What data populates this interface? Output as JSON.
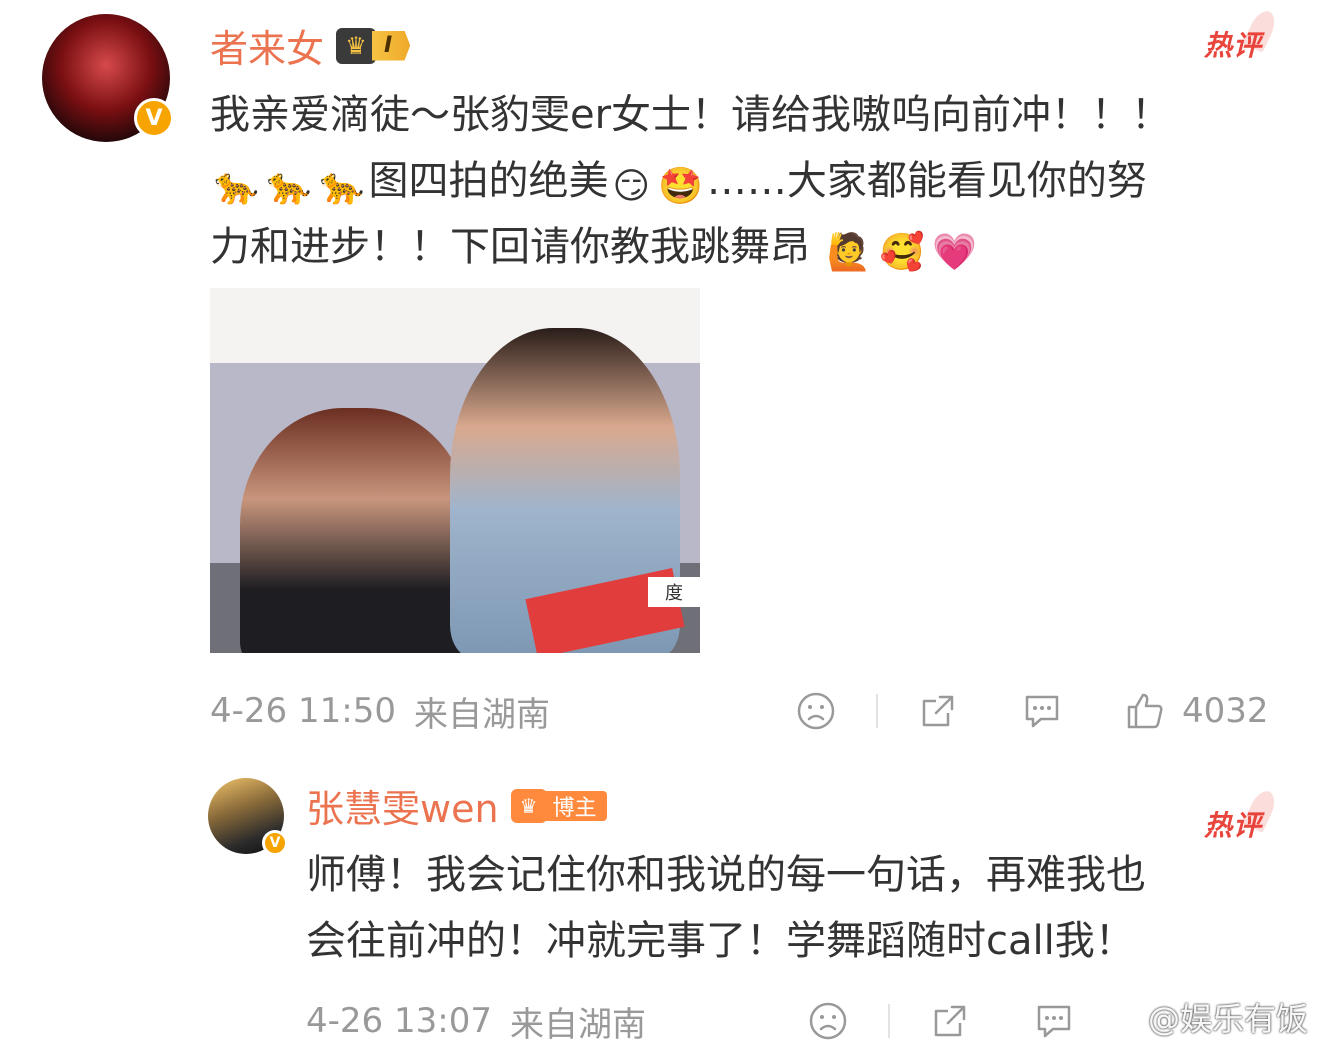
{
  "comments": [
    {
      "username": "者来女",
      "level": "I",
      "hot_label": "热评",
      "text_lines": [
        "我亲爱滴徒～张豹雯er女士！请给我嗷呜向前冲！！！",
        "图四拍的绝美",
        "……大家都能看见你的努",
        "力和进步！！下回请你教我跳舞昂"
      ],
      "emojis_line2": [
        "🐆",
        "🐆",
        "🐆"
      ],
      "emojis_line2_after": [
        "😏",
        "🤩"
      ],
      "emojis_line3": [
        "🙋",
        "🥰",
        "💗"
      ],
      "image_watermark": "度",
      "timestamp": "4-26 11:50",
      "location": "来自湖南",
      "like_count": "4032"
    },
    {
      "username": "张慧雯wen",
      "blogger_badge": "博主",
      "hot_label": "热评",
      "text_lines": [
        "师傅！我会记住你和我说的每一句话，再难我也",
        "会往前冲的！冲就完事了！学舞蹈随时call我！"
      ],
      "timestamp": "4-26 13:07",
      "location": "来自湖南"
    }
  ],
  "site_watermark": "@娱乐有饭",
  "icons": {
    "verified": "V",
    "crown": "♛",
    "accent": "#eb7350",
    "hot": "#e8453c"
  }
}
